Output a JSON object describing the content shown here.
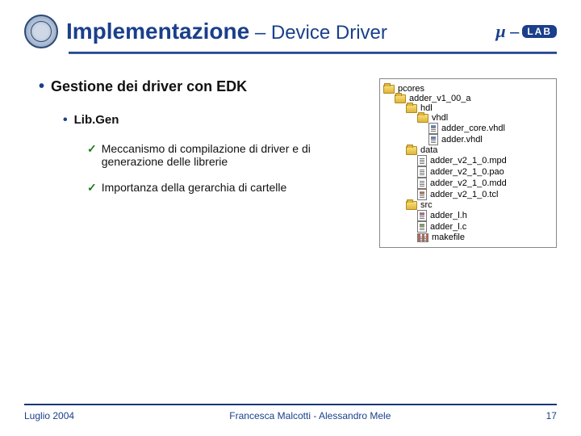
{
  "header": {
    "title_strong": "Implementazione",
    "title_rest": " – Device Driver",
    "logo_mu": "µ –",
    "logo_lab": "LAB"
  },
  "bullets": {
    "b1": "Gestione dei driver con EDK",
    "b2": "Lib.Gen",
    "b3a": "Meccanismo di compilazione di driver e di generazione delle librerie",
    "b3b": "Importanza della gerarchia di cartelle"
  },
  "tree": {
    "n0": "pcores",
    "n1": "adder_v1_00_a",
    "n2": "hdl",
    "n3": "vhdl",
    "n4": "adder_core.vhdl",
    "n5": "adder.vhdl",
    "n6": "data",
    "n7": "adder_v2_1_0.mpd",
    "n8": "adder_v2_1_0.pao",
    "n9": "adder_v2_1_0.mdd",
    "n10": "adder_v2_1_0.tcl",
    "n11": "src",
    "n12": "adder_l.h",
    "n13": "adder_l.c",
    "n14": "makefile"
  },
  "footer": {
    "date": "Luglio 2004",
    "authors": "Francesca Malcotti - Alessandro Mele",
    "page": "17"
  }
}
